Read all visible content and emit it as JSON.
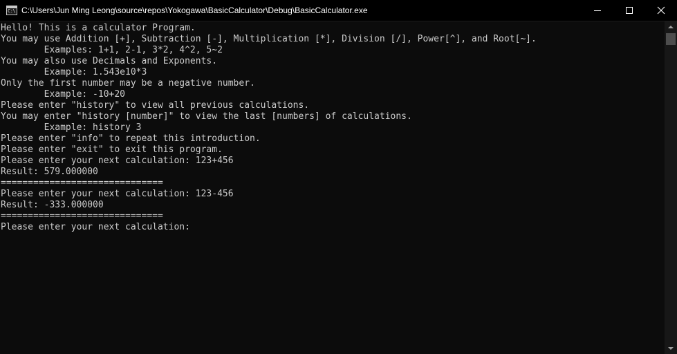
{
  "window": {
    "title": "C:\\Users\\Jun Ming Leong\\source\\repos\\Yokogawa\\BasicCalculator\\Debug\\BasicCalculator.exe",
    "icon": "console-app-icon",
    "icon_text": "C:\\",
    "controls": [
      "minimize",
      "maximize",
      "close"
    ]
  },
  "console": {
    "text_color": "#cccccc",
    "background": "#0c0c0c",
    "lines": [
      "Hello! This is a calculator Program.",
      "You may use Addition [+], Subtraction [-], Multiplication [*], Division [/], Power[^], and Root[~].",
      "        Examples: 1+1, 2-1, 3*2, 4^2, 5~2",
      "You may also use Decimals and Exponents.",
      "        Example: 1.543e10*3",
      "Only the first number may be a negative number.",
      "        Example: -10+20",
      "Please enter \"history\" to view all previous calculations.",
      "You may enter \"history [number]\" to view the last [numbers] of calculations.",
      "        Example: history 3",
      "Please enter \"info\" to repeat this introduction.",
      "Please enter \"exit\" to exit this program.",
      "Please enter your next calculation: 123+456",
      "Result: 579.000000",
      "==============================",
      "Please enter your next calculation: 123-456",
      "Result: -333.000000",
      "==============================",
      "Please enter your next calculation:"
    ]
  }
}
